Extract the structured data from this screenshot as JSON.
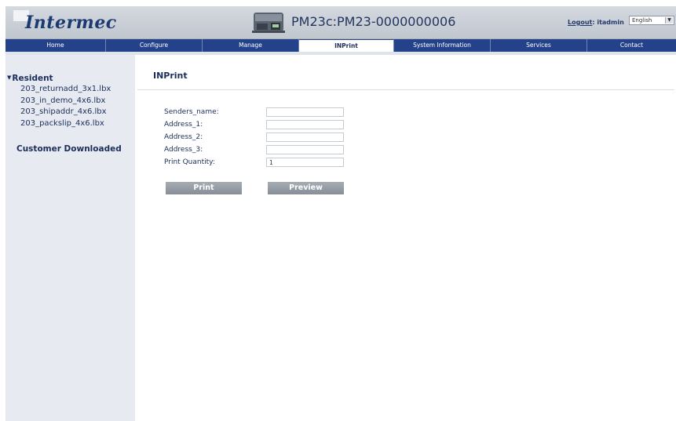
{
  "header": {
    "logo_text": "Intermec",
    "device_title": "PM23c:PM23-0000000006",
    "logout_label": "Logout",
    "user_label": ": itadmin",
    "language_selected": "English"
  },
  "nav": {
    "items": [
      {
        "label": "Home"
      },
      {
        "label": "Configure"
      },
      {
        "label": "Manage"
      },
      {
        "label": "INPrint",
        "active": true
      },
      {
        "label": "System Information"
      },
      {
        "label": "Services"
      },
      {
        "label": "Contact"
      }
    ]
  },
  "sidebar": {
    "group_label": "Resident",
    "items": [
      {
        "label": "203_returnadd_3x1.lbx"
      },
      {
        "label": "203_in_demo_4x6.lbx"
      },
      {
        "label": "203_shipaddr_4x6.lbx"
      },
      {
        "label": "203_packslip_4x6.lbx"
      }
    ],
    "group2_label": "Customer Downloaded"
  },
  "main": {
    "title": "INPrint",
    "fields": [
      {
        "label": "Senders_name:",
        "value": ""
      },
      {
        "label": "Address_1:",
        "value": ""
      },
      {
        "label": "Address_2:",
        "value": ""
      },
      {
        "label": "Address_3:",
        "value": ""
      },
      {
        "label": "Print Quantity:",
        "value": "1"
      }
    ],
    "print_label": "Print",
    "preview_label": "Preview"
  }
}
